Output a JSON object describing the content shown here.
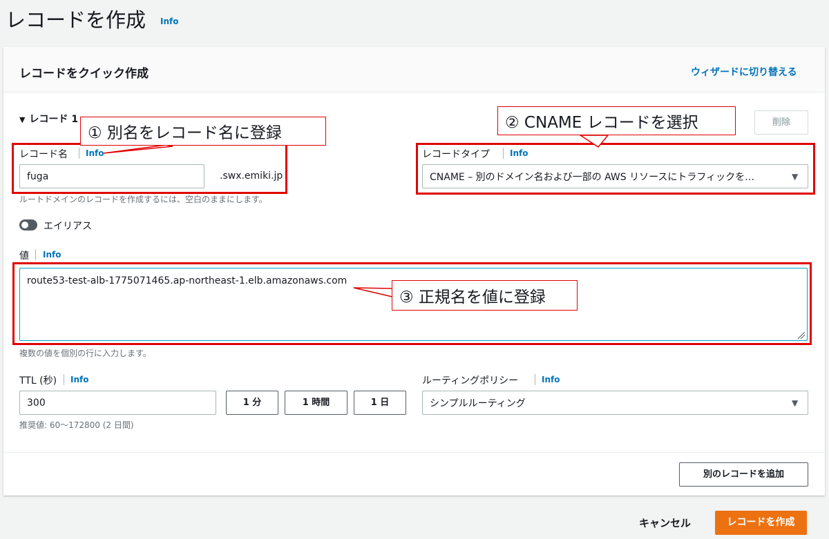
{
  "page": {
    "title": "レコードを作成",
    "title_info": "Info"
  },
  "card": {
    "title": "レコードをクイック作成",
    "switch_wizard": "ウィザードに切り替える",
    "record_section": "レコード 1",
    "delete_label": "削除"
  },
  "record_name": {
    "label": "レコード名",
    "info": "Info",
    "value": "fuga",
    "suffix": ".swx.emiki.jp",
    "hint": "ルートドメインのレコードを作成するには、空白のままにします。"
  },
  "record_type": {
    "label": "レコードタイプ",
    "info": "Info",
    "selected": "CNAME – 別のドメイン名および一部の AWS リソースにトラフィックを…"
  },
  "alias": {
    "label": "エイリアス",
    "enabled": false
  },
  "value": {
    "label": "値",
    "info": "Info",
    "text": "route53-test-alb-1775071465.ap-northeast-1.elb.amazonaws.com",
    "hint": "複数の値を個別の行に入力します。"
  },
  "ttl": {
    "label": "TTL (秒)",
    "info": "Info",
    "value": "300",
    "btn_1min": "1 分",
    "btn_1hour": "1 時間",
    "btn_1day": "1 日",
    "hint": "推奨値: 60～172800 (2 日間)"
  },
  "routing_policy": {
    "label": "ルーティングポリシー",
    "info": "Info",
    "selected": "シンプルルーティング"
  },
  "add_record_label": "別のレコードを追加",
  "footer": {
    "cancel": "キャンセル",
    "create": "レコードを作成"
  },
  "annotations": {
    "step1": "① 別名をレコード名に登録",
    "step2": "② CNAME レコードを選択",
    "step3": "③ 正規名を値に登録"
  },
  "colors": {
    "accent_link": "#0073bb",
    "primary_button": "#ec7211",
    "annotation_red": "#e00000"
  }
}
